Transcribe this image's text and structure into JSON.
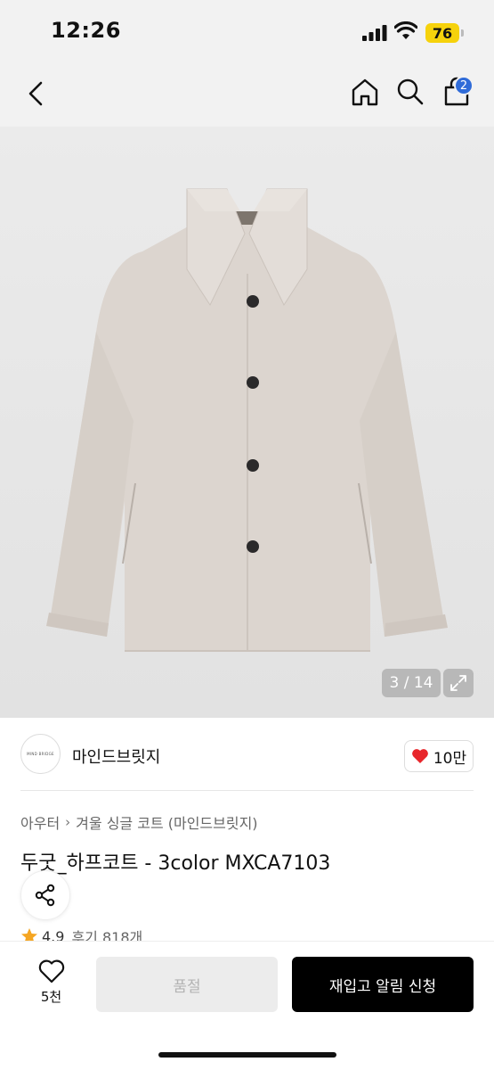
{
  "status_bar": {
    "time": "12:26",
    "battery_level": "76",
    "icons": [
      "signal-icon",
      "wifi-icon",
      "battery-icon"
    ]
  },
  "nav": {
    "icons": [
      "back-icon",
      "home-icon",
      "search-icon",
      "cart-icon"
    ],
    "cart_badge": "2"
  },
  "gallery": {
    "counter": "3 / 14",
    "current_index": 3,
    "total": 14,
    "expand_icon": "expand-icon"
  },
  "brand": {
    "logo_text": "MIND BRIDGE",
    "name": "마인드브릿지",
    "likes": "10만",
    "like_icon": "heart-icon"
  },
  "product": {
    "breadcrumb": [
      "아우터",
      "겨울 싱글 코트 (마인드브릿지)"
    ],
    "title": "두굿_하프코트 - 3color MXCA7103",
    "rating": "4.9",
    "reviews": "후기 818개"
  },
  "bottom_bar": {
    "wish_count": "5천",
    "soldout_label": "품절",
    "restock_label": "재입고 알림 신청"
  },
  "colors": {
    "accent": "#2f6bd8",
    "battery": "#f6d20c",
    "heart": "#e8262b",
    "star": "#f5a623",
    "primary_button": "#000000"
  }
}
